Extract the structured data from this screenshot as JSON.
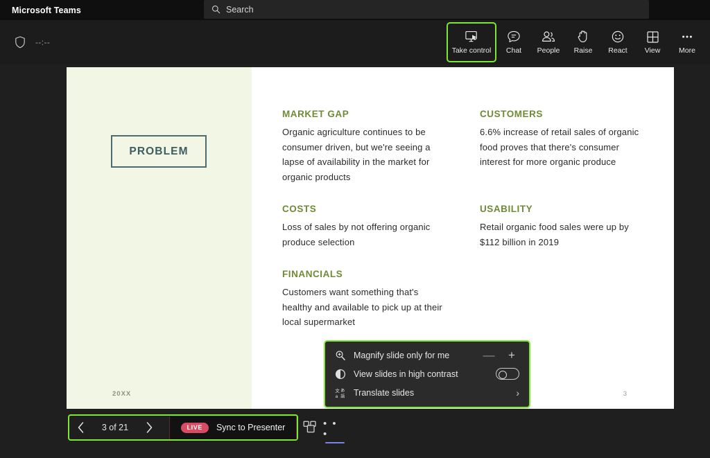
{
  "titlebar": {
    "app_title": "Microsoft Teams",
    "search": {
      "placeholder": "Search",
      "icon": "search-icon"
    }
  },
  "toolbar": {
    "shield_icon": "shield-icon",
    "timer": "--:--",
    "tools": [
      {
        "label": "Take control",
        "icon": "take-control-icon",
        "highlighted": true
      },
      {
        "label": "Chat",
        "icon": "chat-icon",
        "highlighted": false
      },
      {
        "label": "People",
        "icon": "people-icon",
        "highlighted": false
      },
      {
        "label": "Raise",
        "icon": "raise-hand-icon",
        "highlighted": false
      },
      {
        "label": "React",
        "icon": "react-smiley-icon",
        "highlighted": false
      },
      {
        "label": "View",
        "icon": "view-grid-icon",
        "highlighted": false
      },
      {
        "label": "More",
        "icon": "more-ellipsis-icon",
        "highlighted": false
      }
    ]
  },
  "slide": {
    "badge": "PROBLEM",
    "year": "20XX",
    "page_number": "3",
    "blocks": [
      {
        "title": "MARKET GAP",
        "body": "Organic agriculture continues to be consumer driven, but we're seeing a lapse of availability in the market for organic products"
      },
      {
        "title": "CUSTOMERS",
        "body": "6.6% increase of retail sales of organic food proves that there's consumer interest for more organic produce"
      },
      {
        "title": "COSTS",
        "body": "Loss of sales by not offering organic produce selection"
      },
      {
        "title": "USABILITY",
        "body": "Retail organic food sales were up by $112 billion in 2019"
      },
      {
        "title": "FINANCIALS",
        "body": "Customers want something that's healthy and available to pick up at their local supermarket"
      }
    ]
  },
  "popup": {
    "items": [
      {
        "label": "Magnify slide only for me",
        "icon": "magnify-plus-icon",
        "control": "stepper",
        "minus": "—",
        "plus": "+"
      },
      {
        "label": "View slides in high contrast",
        "icon": "contrast-circle-icon",
        "control": "toggle",
        "toggle_on": false
      },
      {
        "label": "Translate slides",
        "icon": "translate-icon",
        "control": "submenu",
        "chevron": "›"
      }
    ]
  },
  "bottombar": {
    "prev_icon": "chevron-left-icon",
    "next_icon": "chevron-right-icon",
    "slide_counter": "3 of 21",
    "live_badge": "LIVE",
    "sync_label": "Sync to Presenter",
    "layout_icon": "layout-swap-icon",
    "more_icon": "more-ellipsis-icon",
    "more_dots": "• • •"
  },
  "colors": {
    "accent_highlight": "#7ee82e",
    "slide_panel": "#f2f6e5",
    "heading_green": "#6f8b35",
    "badge_border": "#4a6b6f",
    "live_red": "#d74b63",
    "active_underline": "#7b83eb"
  }
}
